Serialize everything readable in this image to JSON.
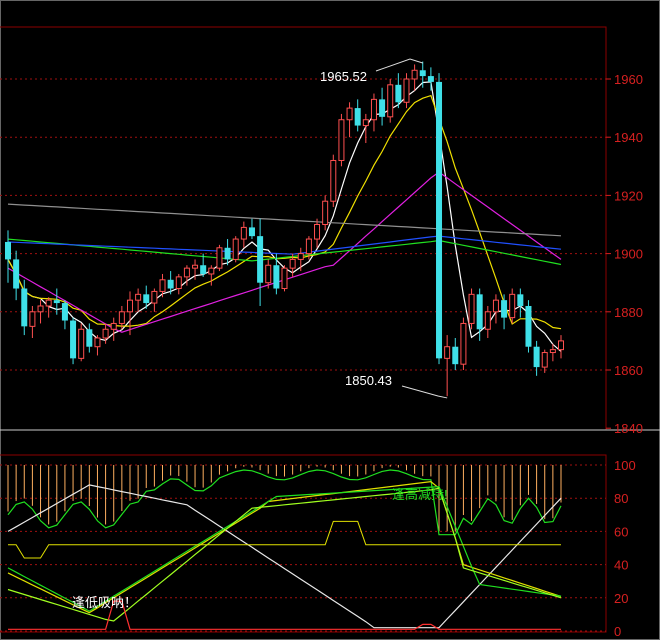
{
  "colors": {
    "frame": "#8b0000",
    "grid": "#a01010",
    "ylabel": "#d62020",
    "candle_up": "#ff5050",
    "candle_down": "#3fe0e8",
    "ma5": "#ffffff",
    "ma10": "#f0e000",
    "ma20": "#e020e0",
    "ma60": "#20e020",
    "ma120": "#2050ff",
    "ma250": "#909090",
    "osc_white": "#e8e8e8",
    "osc_green": "#20e020",
    "osc_light_green": "#a0ff20",
    "osc_yellow": "#e0e000",
    "osc_orange": "#ffb060",
    "osc_red": "#ff3030"
  },
  "chart_data": [
    {
      "type": "candlestick",
      "yticks": [
        1840,
        1860,
        1880,
        1900,
        1920,
        1940,
        1960
      ],
      "ylim": [
        1840,
        1975
      ],
      "grid": true,
      "annotations": {
        "high_label": "1965.52",
        "low_label": "1850.43"
      },
      "candles": [
        [
          1904,
          1908,
          1890,
          1898
        ],
        [
          1898,
          1901,
          1884,
          1888
        ],
        [
          1888,
          1891,
          1872,
          1875
        ],
        [
          1875,
          1882,
          1871,
          1880
        ],
        [
          1880,
          1884,
          1876,
          1882
        ],
        [
          1882,
          1885,
          1878,
          1884
        ],
        [
          1884,
          1888,
          1879,
          1883
        ],
        [
          1883,
          1884,
          1874,
          1877
        ],
        [
          1877,
          1878,
          1862,
          1864
        ],
        [
          1864,
          1876,
          1863,
          1874
        ],
        [
          1874,
          1876,
          1866,
          1868
        ],
        [
          1868,
          1872,
          1865,
          1871
        ],
        [
          1871,
          1876,
          1869,
          1874
        ],
        [
          1874,
          1878,
          1870,
          1876
        ],
        [
          1876,
          1882,
          1874,
          1880
        ],
        [
          1880,
          1887,
          1872,
          1884
        ],
        [
          1884,
          1888,
          1880,
          1886
        ],
        [
          1886,
          1889,
          1881,
          1883
        ],
        [
          1883,
          1888,
          1880,
          1887
        ],
        [
          1887,
          1893,
          1885,
          1891
        ],
        [
          1891,
          1894,
          1886,
          1888
        ],
        [
          1888,
          1893,
          1886,
          1892
        ],
        [
          1892,
          1896,
          1889,
          1895
        ],
        [
          1895,
          1898,
          1891,
          1896
        ],
        [
          1896,
          1900,
          1892,
          1893
        ],
        [
          1893,
          1896,
          1889,
          1895
        ],
        [
          1895,
          1903,
          1894,
          1902
        ],
        [
          1902,
          1905,
          1896,
          1898
        ],
        [
          1898,
          1906,
          1897,
          1905
        ],
        [
          1905,
          1911,
          1902,
          1909
        ],
        [
          1909,
          1912,
          1905,
          1906
        ],
        [
          1906,
          1912,
          1882,
          1890
        ],
        [
          1890,
          1898,
          1888,
          1896
        ],
        [
          1896,
          1900,
          1886,
          1888
        ],
        [
          1888,
          1896,
          1887,
          1895
        ],
        [
          1895,
          1900,
          1892,
          1898
        ],
        [
          1898,
          1902,
          1894,
          1900
        ],
        [
          1900,
          1906,
          1898,
          1905
        ],
        [
          1905,
          1912,
          1902,
          1910
        ],
        [
          1910,
          1920,
          1908,
          1918
        ],
        [
          1918,
          1934,
          1916,
          1932
        ],
        [
          1932,
          1948,
          1930,
          1946
        ],
        [
          1946,
          1952,
          1940,
          1950
        ],
        [
          1950,
          1953,
          1942,
          1944
        ],
        [
          1944,
          1948,
          1938,
          1946
        ],
        [
          1946,
          1955,
          1942,
          1953
        ],
        [
          1953,
          1957,
          1944,
          1947
        ],
        [
          1947,
          1960,
          1945,
          1958
        ],
        [
          1958,
          1962,
          1950,
          1952
        ],
        [
          1952,
          1962,
          1950,
          1960
        ],
        [
          1960,
          1965,
          1956,
          1963
        ],
        [
          1963,
          1966,
          1957,
          1961
        ],
        [
          1961,
          1964,
          1956,
          1959
        ],
        [
          1959,
          1962,
          1862,
          1864
        ],
        [
          1864,
          1872,
          1851,
          1868
        ],
        [
          1868,
          1871,
          1860,
          1862
        ],
        [
          1862,
          1878,
          1860,
          1876
        ],
        [
          1876,
          1888,
          1874,
          1886
        ],
        [
          1886,
          1888,
          1870,
          1874
        ],
        [
          1874,
          1882,
          1871,
          1880
        ],
        [
          1880,
          1886,
          1876,
          1884
        ],
        [
          1884,
          1886,
          1874,
          1878
        ],
        [
          1878,
          1888,
          1876,
          1886
        ],
        [
          1886,
          1888,
          1878,
          1882
        ],
        [
          1882,
          1884,
          1866,
          1868
        ],
        [
          1868,
          1870,
          1858,
          1861
        ],
        [
          1861,
          1867,
          1859,
          1866
        ],
        [
          1866,
          1869,
          1863,
          1867
        ],
        [
          1867,
          1872,
          1864,
          1870
        ]
      ]
    },
    {
      "type": "oscillator",
      "yticks": [
        0,
        20,
        40,
        60,
        80,
        100
      ],
      "ylim": [
        0,
        100
      ],
      "annotations": {
        "buy_label": "逢低吸呐！",
        "sell_label": "逢高减持!"
      }
    }
  ]
}
